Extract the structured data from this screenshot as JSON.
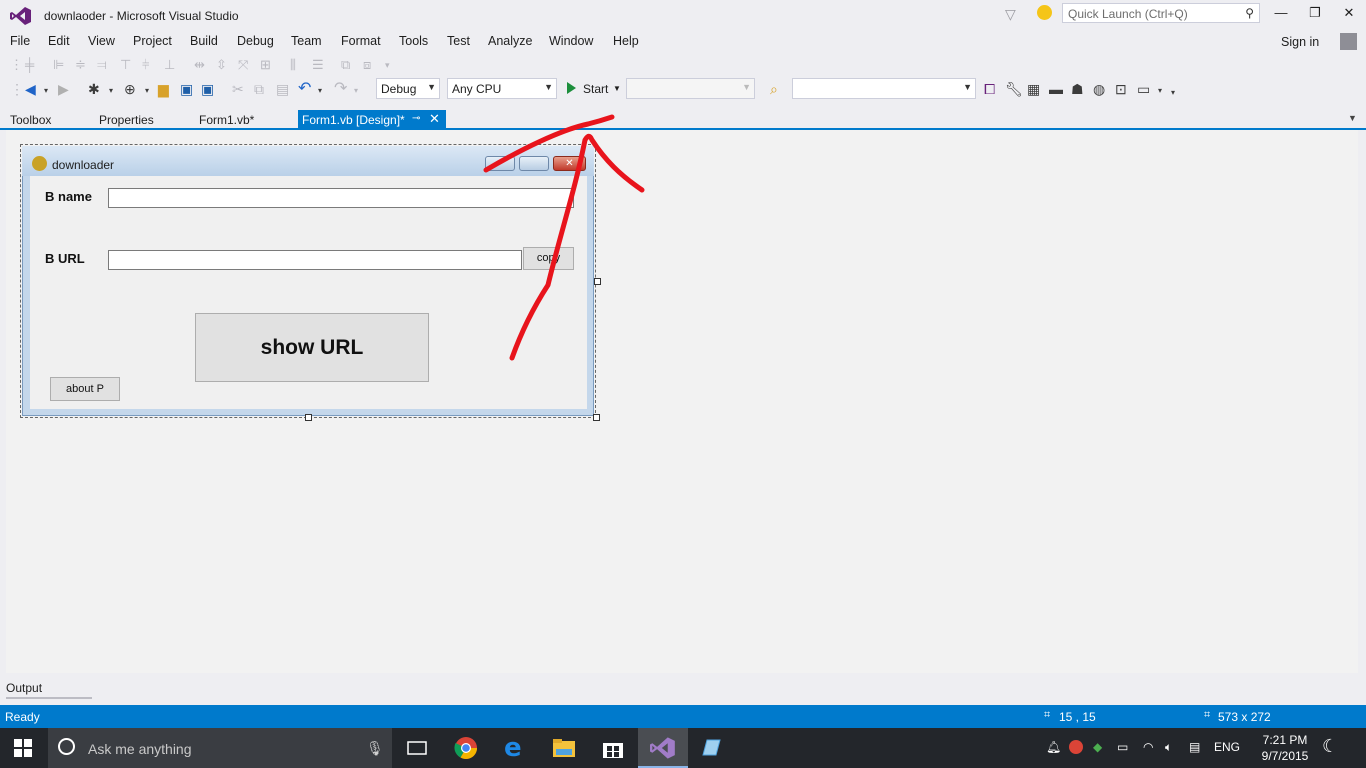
{
  "window": {
    "title": "downlaoder - Microsoft Visual Studio",
    "quick_launch_placeholder": "Quick Launch (Ctrl+Q)",
    "sign_in": "Sign in"
  },
  "menu": [
    "File",
    "Edit",
    "View",
    "Project",
    "Build",
    "Debug",
    "Team",
    "Format",
    "Tools",
    "Test",
    "Analyze",
    "Window",
    "Help"
  ],
  "toolbar": {
    "config": "Debug",
    "platform": "Any CPU",
    "start": "Start",
    "target": "",
    "find": ""
  },
  "tabs": {
    "toolbox": "Toolbox",
    "properties": "Properties",
    "form_code": "Form1.vb*",
    "form_design": "Form1.vb [Design]*"
  },
  "form": {
    "title": "downloader",
    "name_label": "B name",
    "url_label": "B URL",
    "copy_button": "copy",
    "show_button": "show URL",
    "about_button": "about P",
    "name_value": "",
    "url_value": ""
  },
  "output_label": "Output",
  "status": {
    "text": "Ready",
    "position": "15 , 15",
    "size": "573 x 272"
  },
  "taskbar": {
    "search": "Ask me anything",
    "lang": "ENG",
    "time": "7:21 PM",
    "date": "9/7/2015"
  },
  "colors": {
    "accent": "#007acc",
    "annotation": "#e8141c",
    "taskbar": "#23262b"
  }
}
